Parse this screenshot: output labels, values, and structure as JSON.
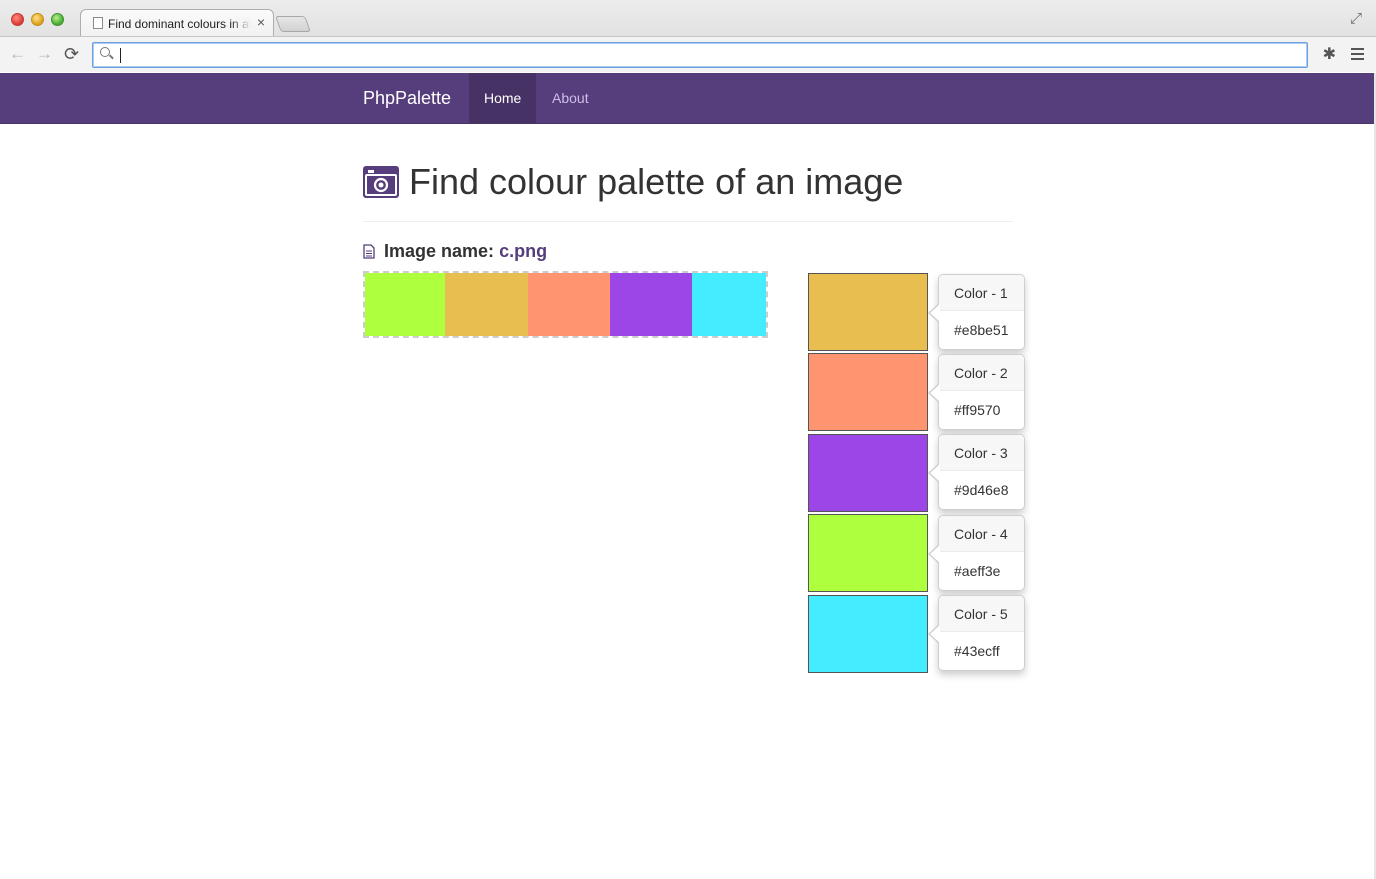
{
  "browser": {
    "tab_title": "Find dominant colours in an image",
    "tab_close": "×",
    "fullscreen_icon": "⤢",
    "back_icon": "←",
    "forward_icon": "→",
    "reload_icon": "⟳",
    "extension_icon": "✱",
    "address_value": ""
  },
  "navbar": {
    "brand": "PhpPalette",
    "items": [
      {
        "label": "Home",
        "active": true
      },
      {
        "label": "About",
        "active": false
      }
    ],
    "color": "#563d7c"
  },
  "page": {
    "title": "Find colour palette of an image",
    "image_label": "Image name:",
    "image_file": "c.png"
  },
  "preview": {
    "colors": [
      "#aeff3e",
      "#e8be51",
      "#ff9570",
      "#9d46e8",
      "#43ecff"
    ]
  },
  "palette": [
    {
      "label": "Color - 1",
      "hex": "#e8be51"
    },
    {
      "label": "Color - 2",
      "hex": "#ff9570"
    },
    {
      "label": "Color - 3",
      "hex": "#9d46e8"
    },
    {
      "label": "Color - 4",
      "hex": "#aeff3e"
    },
    {
      "label": "Color - 5",
      "hex": "#43ecff"
    }
  ]
}
